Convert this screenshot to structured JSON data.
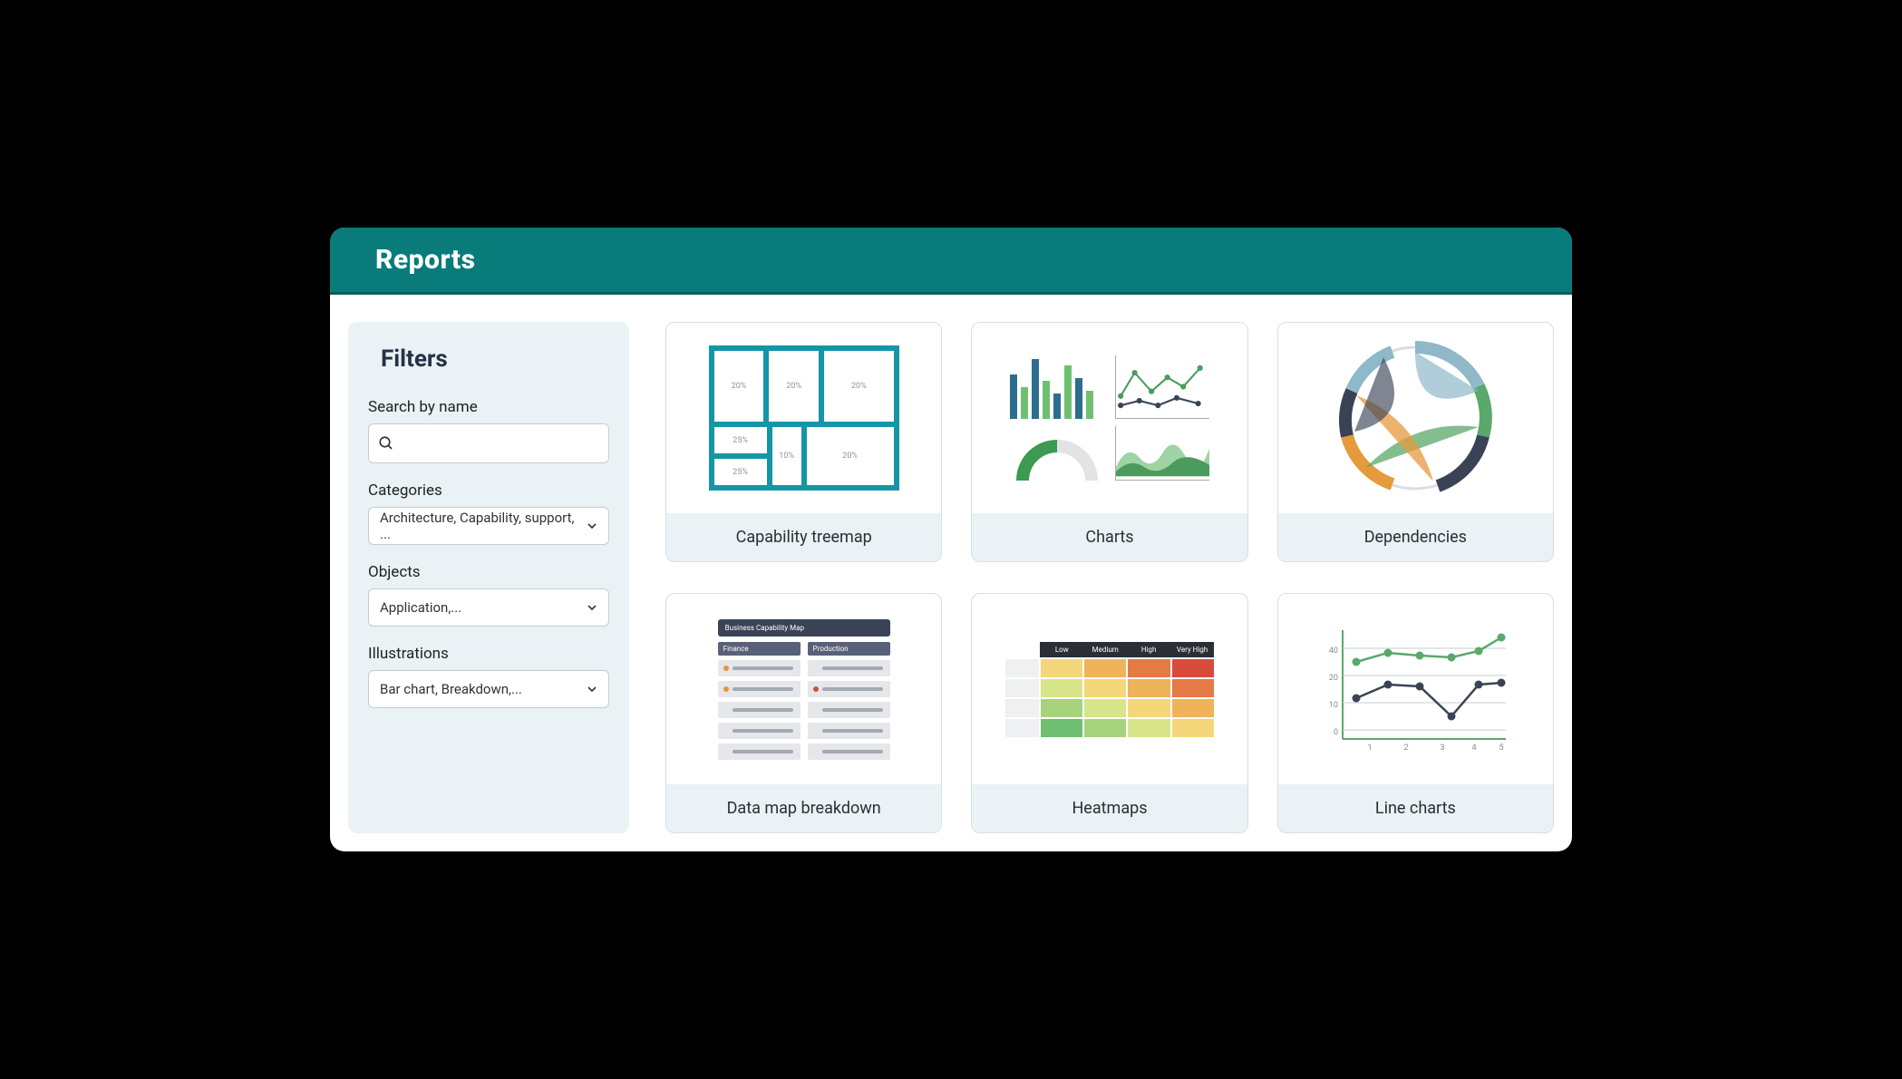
{
  "header": {
    "title": "Reports"
  },
  "sidebar": {
    "title": "Filters",
    "search_label": "Search by name",
    "search_value": "",
    "categories_label": "Categories",
    "categories_value": "Architecture, Capability, support, ...",
    "objects_label": "Objects",
    "objects_value": "Application,...",
    "illustrations_label": "Illustrations",
    "illustrations_value": "Bar chart, Breakdown,..."
  },
  "cards": [
    {
      "label": "Capability treemap"
    },
    {
      "label": "Charts"
    },
    {
      "label": "Dependencies"
    },
    {
      "label": "Data map breakdown"
    },
    {
      "label": "Heatmaps"
    },
    {
      "label": "Line charts"
    }
  ],
  "thumbnails": {
    "datamap_title": "Business Capability Map",
    "datamap_col1": "Finance",
    "datamap_col2": "Production",
    "heatmap_headers": [
      "Low",
      "Medium",
      "High",
      "Very High"
    ]
  }
}
